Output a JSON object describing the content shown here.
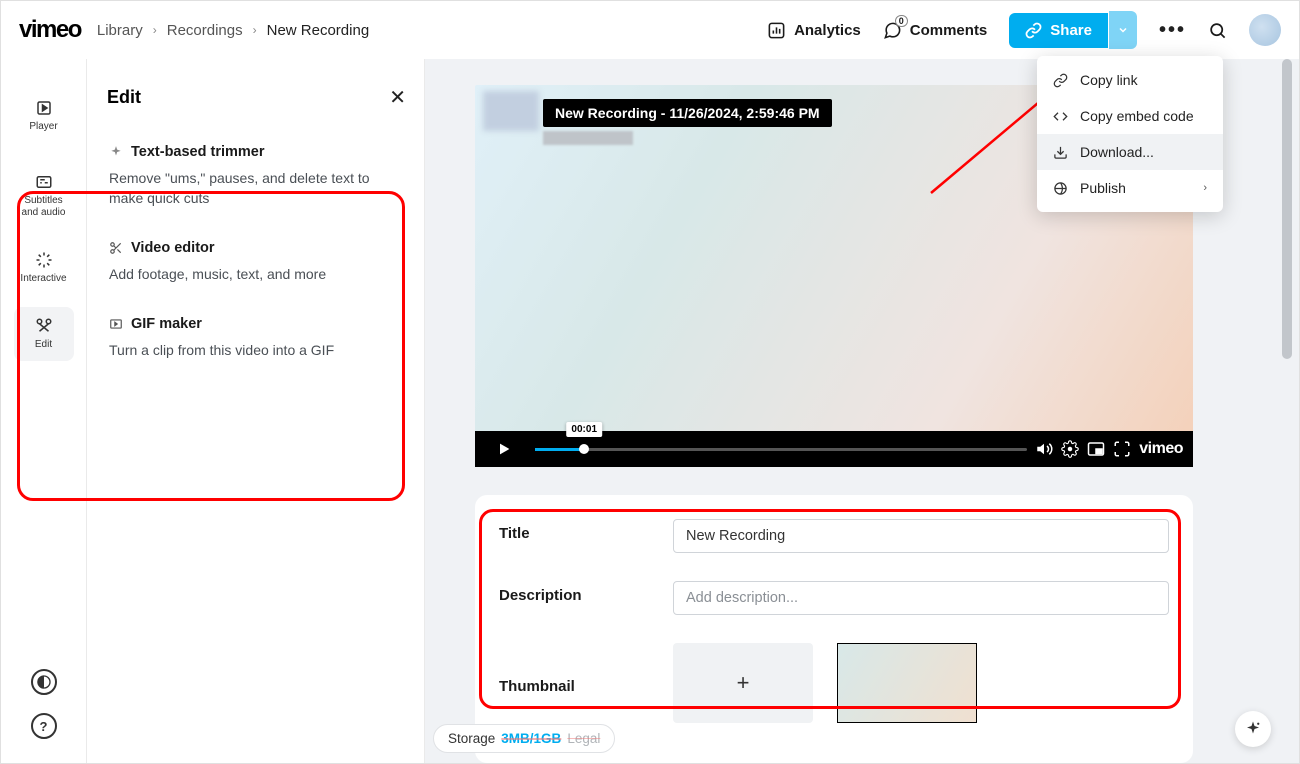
{
  "logo": "vimeo",
  "breadcrumb": {
    "library": "Library",
    "recordings": "Recordings",
    "current": "New Recording"
  },
  "topbar": {
    "analytics": "Analytics",
    "comments": "Comments",
    "comments_badge": "0",
    "share": "Share"
  },
  "share_menu": {
    "copy_link": "Copy link",
    "copy_embed": "Copy embed code",
    "download": "Download...",
    "publish": "Publish"
  },
  "rail": {
    "player": "Player",
    "subtitles": "Subtitles and audio",
    "interactive": "Interactive",
    "edit": "Edit"
  },
  "edit_panel": {
    "title": "Edit",
    "text_trimmer": {
      "title": "Text-based trimmer",
      "desc": "Remove \"ums,\" pauses, and delete text to make quick cuts"
    },
    "video_editor": {
      "title": "Video editor",
      "desc": "Add footage, music, text, and more"
    },
    "gif_maker": {
      "title": "GIF maker",
      "desc": "Turn a clip from this video into a GIF"
    }
  },
  "video": {
    "title_overlay": "New Recording - 11/26/2024, 2:59:46 PM",
    "time_tooltip": "00:01",
    "brand": "vimeo"
  },
  "details": {
    "title_label": "Title",
    "title_value": "New Recording",
    "desc_label": "Description",
    "desc_placeholder": "Add description...",
    "thumb_label": "Thumbnail"
  },
  "storage": {
    "label": "Storage",
    "ratio": "3MB/1GB",
    "legal": "Legal"
  },
  "help": "?"
}
